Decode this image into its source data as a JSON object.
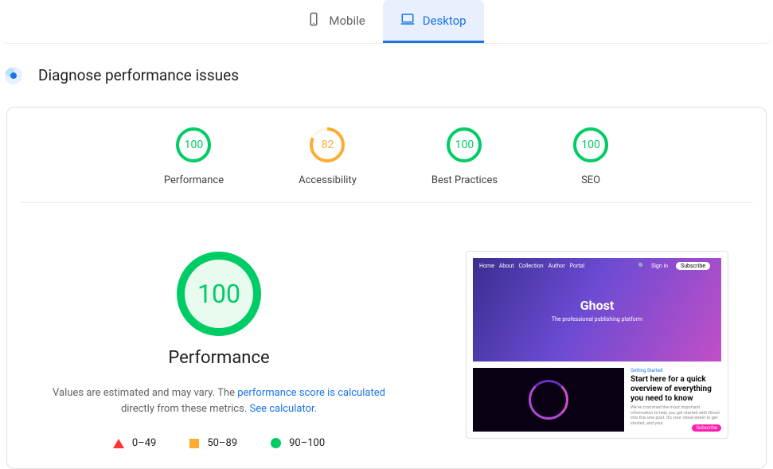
{
  "tabs": {
    "mobile": "Mobile",
    "desktop": "Desktop"
  },
  "section_title": "Diagnose performance issues",
  "gauges": [
    {
      "label": "Performance",
      "score": 100,
      "color": "#0c6",
      "bg": "#e9faef",
      "pct": 100
    },
    {
      "label": "Accessibility",
      "score": 82,
      "color": "#fa3",
      "bg": "#fff7e6",
      "pct": 82
    },
    {
      "label": "Best Practices",
      "score": 100,
      "color": "#0c6",
      "bg": "#e9faef",
      "pct": 100
    },
    {
      "label": "SEO",
      "score": 100,
      "color": "#0c6",
      "bg": "#e9faef",
      "pct": 100
    }
  ],
  "big_gauge": {
    "score": 100,
    "label": "Performance"
  },
  "desc": {
    "prefix": "Values are estimated and may vary. The ",
    "link1": "performance score is calculated",
    "mid": " directly from these metrics. ",
    "link2": "See calculator"
  },
  "legend": {
    "fail": "0–49",
    "avg": "50–89",
    "pass": "90–100"
  },
  "screenshot": {
    "nav": [
      "Home",
      "About",
      "Collection",
      "Author",
      "Portal"
    ],
    "right_nav": {
      "signin": "Sign in",
      "subscribe": "Subscribe",
      "search": "🔍"
    },
    "hero_title": "Ghost",
    "hero_subtitle": "The professional publishing platform",
    "article": {
      "category": "Getting Started",
      "title": "Start here for a quick overview of everything you need to know",
      "excerpt": "We've crammed the most important information to help you get started with Ghost into this one post. It's your cheat-sheet to get started, and your",
      "sub": "Subscribe"
    }
  }
}
